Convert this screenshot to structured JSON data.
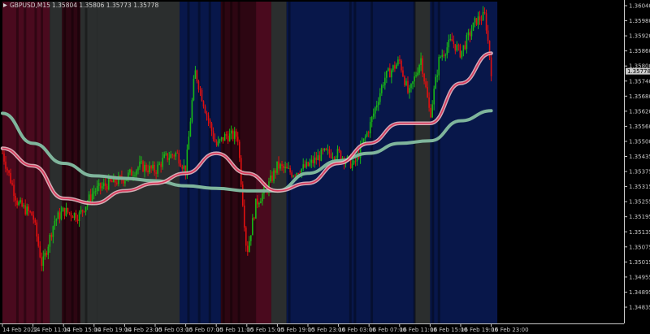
{
  "header": {
    "symbol_label": "GBPUSD,M15",
    "ohlc_text": "1.35804 1.35806 1.35773 1.35778"
  },
  "colors": {
    "background": "#000000",
    "candle_up": "#18b818",
    "candle_down": "#e01010",
    "ma_red_line": "#d9385a",
    "ma_red_glow": "#f0c4cc",
    "ma_green": "#7fb59c",
    "zone_red": "#2d0612",
    "zone_red_bright": "#4a0a1e",
    "zone_gray": "#2b2e2e",
    "zone_blue": "#08174a",
    "grid": "#3a3a3a",
    "price_tag_bg": "#c9c9c9"
  },
  "price_axis": {
    "labels": [
      "1.36040",
      "1.35980",
      "1.35920",
      "1.35860",
      "1.35800",
      "1.35740",
      "1.35680",
      "1.35620",
      "1.35560",
      "1.35500",
      "1.35435",
      "1.35375",
      "1.35315",
      "1.35255",
      "1.35195",
      "1.35135",
      "1.35075",
      "1.35015",
      "1.34955",
      "1.34895",
      "1.34835"
    ],
    "current_price_label": "1.35778"
  },
  "time_axis": {
    "labels": [
      "14 Feb 2022",
      "14 Feb 11:00",
      "14 Feb 15:00",
      "14 Feb 19:00",
      "14 Feb 23:00",
      "15 Feb 03:00",
      "15 Feb 07:00",
      "15 Feb 11:00",
      "15 Feb 15:00",
      "15 Feb 19:00",
      "15 Feb 23:00",
      "16 Feb 03:00",
      "16 Feb 07:00",
      "16 Feb 11:00",
      "16 Feb 15:00",
      "16 Feb 19:00",
      "16 Feb 23:00"
    ]
  },
  "chart_data": {
    "type": "candlestick",
    "symbol": "GBPUSD",
    "timeframe": "M15",
    "ylim": [
      1.348,
      1.3607
    ],
    "x_categories": [
      "14 Feb 2022",
      "14 Feb 11:00",
      "14 Feb 15:00",
      "14 Feb 19:00",
      "14 Feb 23:00",
      "15 Feb 03:00",
      "15 Feb 07:00",
      "15 Feb 11:00",
      "15 Feb 15:00",
      "15 Feb 19:00",
      "15 Feb 23:00",
      "16 Feb 03:00",
      "16 Feb 07:00",
      "16 Feb 11:00",
      "16 Feb 15:00",
      "16 Feb 19:00",
      "16 Feb 23:00"
    ],
    "price_path": [
      [
        0,
        1.3545
      ],
      [
        0.5,
        1.3525
      ],
      [
        1,
        1.352
      ],
      [
        1.3,
        1.35
      ],
      [
        1.7,
        1.3518
      ],
      [
        2,
        1.3522
      ],
      [
        2.5,
        1.352
      ],
      [
        3,
        1.353
      ],
      [
        3.5,
        1.3533
      ],
      [
        4,
        1.3535
      ],
      [
        4.5,
        1.354
      ],
      [
        5,
        1.3538
      ],
      [
        5.3,
        1.3543
      ],
      [
        5.7,
        1.3545
      ],
      [
        6,
        1.3538
      ],
      [
        6.3,
        1.3578
      ],
      [
        6.7,
        1.356
      ],
      [
        7,
        1.3548
      ],
      [
        7.3,
        1.3552
      ],
      [
        7.7,
        1.3552
      ],
      [
        8,
        1.3505
      ],
      [
        8.3,
        1.3525
      ],
      [
        8.7,
        1.3532
      ],
      [
        9,
        1.354
      ],
      [
        9.5,
        1.3537
      ],
      [
        10,
        1.354
      ],
      [
        10.5,
        1.3545
      ],
      [
        11,
        1.3545
      ],
      [
        11.5,
        1.354
      ],
      [
        12,
        1.3555
      ],
      [
        12.5,
        1.3575
      ],
      [
        13,
        1.3582
      ],
      [
        13.3,
        1.3568
      ],
      [
        13.7,
        1.3583
      ],
      [
        14,
        1.356
      ],
      [
        14.3,
        1.3583
      ],
      [
        14.7,
        1.359
      ],
      [
        15,
        1.3585
      ],
      [
        15.5,
        1.3598
      ],
      [
        15.8,
        1.36
      ],
      [
        16,
        1.3578
      ]
    ],
    "series": [
      {
        "name": "",
        "type": "line",
        "points": [
          [
            0,
            1.3561
          ],
          [
            1,
            1.3549
          ],
          [
            2,
            1.3541
          ],
          [
            3,
            1.3536
          ],
          [
            4,
            1.3535
          ],
          [
            5,
            1.3534
          ],
          [
            6,
            1.3532
          ],
          [
            7,
            1.3531
          ],
          [
            8,
            1.353
          ],
          [
            9,
            1.353
          ],
          [
            10,
            1.3537
          ],
          [
            11,
            1.3542
          ],
          [
            12,
            1.3545
          ],
          [
            13,
            1.3549
          ],
          [
            14,
            1.355
          ],
          [
            15,
            1.3558
          ],
          [
            16,
            1.3562
          ]
        ]
      },
      {
        "name": "",
        "type": "line",
        "points": [
          [
            0,
            1.3547
          ],
          [
            1,
            1.354
          ],
          [
            2,
            1.3527
          ],
          [
            3,
            1.3525
          ],
          [
            4,
            1.353
          ],
          [
            5,
            1.3533
          ],
          [
            6,
            1.3537
          ],
          [
            7,
            1.3545
          ],
          [
            8,
            1.3537
          ],
          [
            9,
            1.353
          ],
          [
            10,
            1.3533
          ],
          [
            11,
            1.3541
          ],
          [
            12,
            1.3549
          ],
          [
            13,
            1.3557
          ],
          [
            14,
            1.3557
          ],
          [
            15,
            1.3573
          ],
          [
            16,
            1.3585
          ]
        ]
      }
    ],
    "background_zones": [
      {
        "from": 0,
        "to": 1.55,
        "color": "zone_red_bright"
      },
      {
        "from": 1.55,
        "to": 1.95,
        "color": "zone_gray"
      },
      {
        "from": 1.95,
        "to": 2.55,
        "color": "zone_red"
      },
      {
        "from": 2.55,
        "to": 3.1,
        "color": "zone_gray"
      },
      {
        "from": 3.1,
        "to": 5.8,
        "color": "zone_gray"
      },
      {
        "from": 5.8,
        "to": 7.15,
        "color": "zone_blue"
      },
      {
        "from": 7.15,
        "to": 8.3,
        "color": "zone_red"
      },
      {
        "from": 8.3,
        "to": 8.8,
        "color": "zone_red_bright"
      },
      {
        "from": 8.8,
        "to": 9.3,
        "color": "zone_gray"
      },
      {
        "from": 9.3,
        "to": 13.5,
        "color": "zone_blue"
      },
      {
        "from": 13.5,
        "to": 14.0,
        "color": "zone_gray"
      },
      {
        "from": 14.0,
        "to": 16.2,
        "color": "zone_blue"
      }
    ],
    "grid": false,
    "legend": "none"
  }
}
